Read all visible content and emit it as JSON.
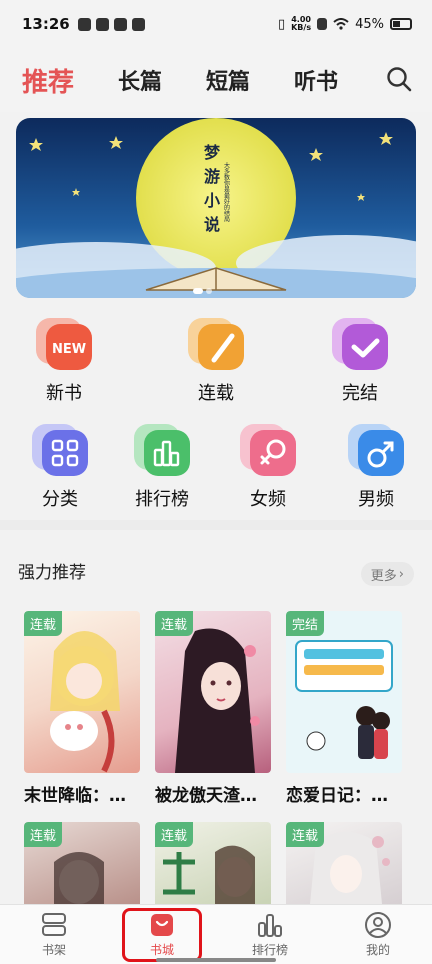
{
  "status": {
    "time": "13:26",
    "net_speed_value": "4.00",
    "net_speed_unit": "KB/s",
    "battery": "45%"
  },
  "nav": {
    "tabs": [
      "推荐",
      "长篇",
      "短篇",
      "听书"
    ],
    "active": "推荐"
  },
  "banner": {
    "title_chars": [
      "梦",
      "游",
      "小",
      "说"
    ],
    "subtitle": "大多数你是最好的结局"
  },
  "entries_row1": [
    {
      "label": "新书",
      "badge": "NEW",
      "icon": "new-book-icon",
      "color": "#ee5a40"
    },
    {
      "label": "连载",
      "icon": "pencil-icon",
      "color": "#f1a234"
    },
    {
      "label": "完结",
      "icon": "check-icon",
      "color": "#b25ad8"
    }
  ],
  "entries_row2": [
    {
      "label": "分类",
      "icon": "grid-icon",
      "color": "#6b71e8"
    },
    {
      "label": "排行榜",
      "icon": "bar-chart-icon",
      "color": "#4bbf6a"
    },
    {
      "label": "女频",
      "icon": "female-icon",
      "color": "#ee6d8c"
    },
    {
      "label": "男频",
      "icon": "male-icon",
      "color": "#3a8be8"
    }
  ],
  "section": {
    "title": "强力推荐",
    "more": "更多"
  },
  "books_row1": [
    {
      "tag": "连载",
      "title": "末世降临：…"
    },
    {
      "tag": "连载",
      "title": "被龙傲天渣…"
    },
    {
      "tag": "完结",
      "title": "恋爱日记：…"
    }
  ],
  "books_row2": [
    {
      "tag": "连载"
    },
    {
      "tag": "连载"
    },
    {
      "tag": "连载"
    }
  ],
  "bottom_tabs": [
    {
      "label": "书架",
      "icon": "bookshelf-icon"
    },
    {
      "label": "书城",
      "icon": "store-icon"
    },
    {
      "label": "排行榜",
      "icon": "ranking-icon"
    },
    {
      "label": "我的",
      "icon": "profile-icon"
    }
  ],
  "active_tab": "书城",
  "colors": {
    "accent": "#e45455",
    "tag_green": "#57b67a"
  }
}
